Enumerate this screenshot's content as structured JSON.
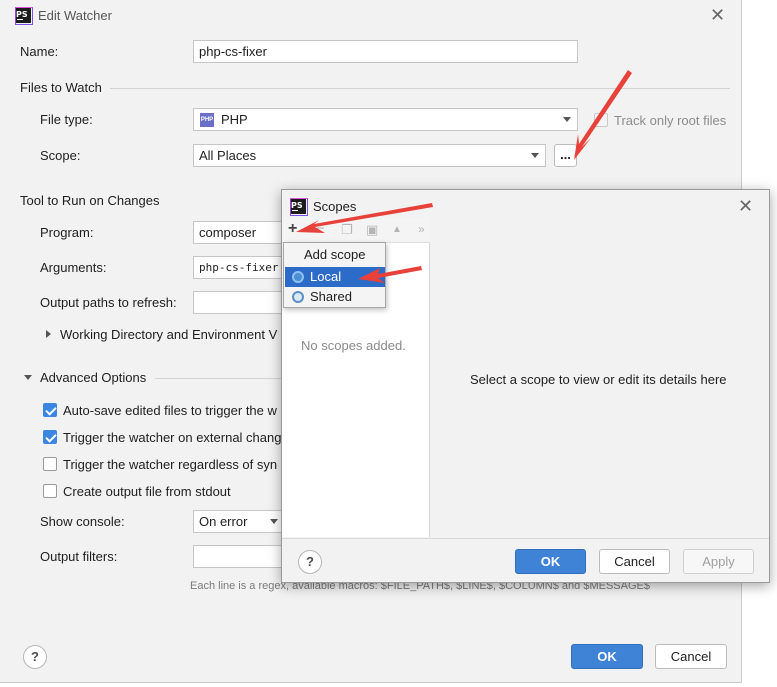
{
  "main": {
    "title": "Edit Watcher",
    "name_label": "Name:",
    "name_value": "php-cs-fixer",
    "files_to_watch_heading": "Files to Watch",
    "file_type_label": "File type:",
    "file_type_value": "PHP",
    "track_root_label": "Track only root files",
    "scope_label": "Scope:",
    "scope_value": "All Places",
    "scope_browse": "...",
    "tool_heading": "Tool to Run on Changes",
    "program_label": "Program:",
    "program_value": "composer",
    "arguments_label": "Arguments:",
    "arguments_value": "php-cs-fixer -",
    "output_paths_label": "Output paths to refresh:",
    "workdir_label": "Working Directory and Environment V",
    "advanced_heading": "Advanced Options",
    "chk_autosave": "Auto-save edited files to trigger the w",
    "chk_external": "Trigger the watcher on external chang",
    "chk_regardless": "Trigger the watcher regardless of syn",
    "chk_stdout": "Create output file from stdout",
    "show_console_label": "Show console:",
    "show_console_value": "On error",
    "output_filters_label": "Output filters:",
    "filters_hint": "Each line is a regex, available macros: $FILE_PATH$, $LINE$, $COLUMN$ and $MESSAGE$",
    "help": "?",
    "ok": "OK",
    "cancel": "Cancel",
    "logo": "PS"
  },
  "scopes": {
    "title": "Scopes",
    "empty_text": "No scopes added.",
    "details_hint": "Select a scope to view or edit its details here",
    "ok": "OK",
    "cancel": "Cancel",
    "apply": "Apply",
    "help": "?",
    "toolbar": {
      "add": "+",
      "remove": "−",
      "copy": "❐",
      "save": "▣",
      "up": "▲",
      "down": "▼",
      "more": "»"
    }
  },
  "popup": {
    "title": "Add scope",
    "items": [
      "Local",
      "Shared"
    ]
  },
  "background_fragments": [
    "di",
    "s-",
    "cs"
  ],
  "colors": {
    "accent": "#3e83d6",
    "selection": "#2d6bc9",
    "arrow": "#e8413a",
    "dialog_bg": "#f2f2f2"
  }
}
